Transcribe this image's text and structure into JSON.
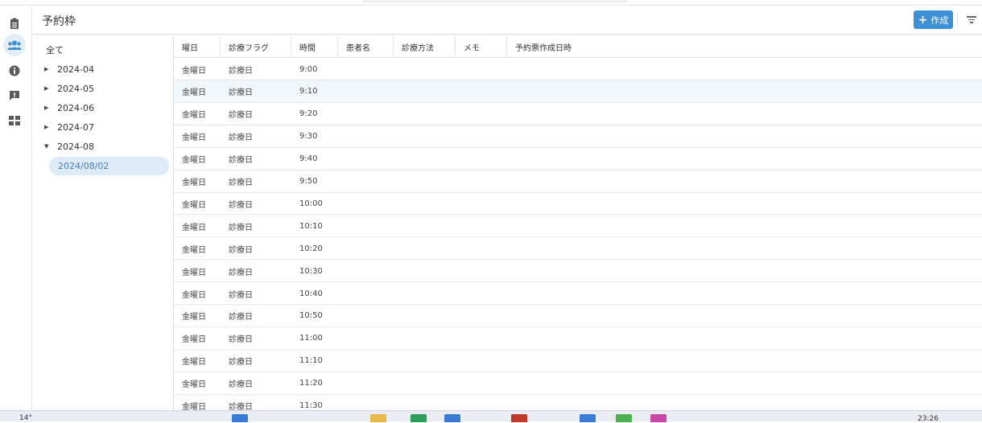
{
  "header": {
    "title": "予約枠",
    "create_label": "作成"
  },
  "icons": {
    "rail": [
      "clipboard-icon",
      "users-icon",
      "info-icon",
      "feedback-icon",
      "dashboard-icon"
    ],
    "create": "plus-icon",
    "filter": "filter-icon"
  },
  "colors": {
    "accent": "#3d8fd6",
    "selected_bg": "#ddeaf7",
    "selected_text": "#4a7fb5",
    "hover_row": "#f2f7fc"
  },
  "tree": {
    "all_label": "全て",
    "months": [
      {
        "label": "2024-04",
        "expanded": false
      },
      {
        "label": "2024-05",
        "expanded": false
      },
      {
        "label": "2024-06",
        "expanded": false
      },
      {
        "label": "2024-07",
        "expanded": false
      },
      {
        "label": "2024-08",
        "expanded": true
      }
    ],
    "selected_day": "2024/08/02"
  },
  "table": {
    "columns": [
      "曜日",
      "診療フラグ",
      "時間",
      "患者名",
      "診療方法",
      "メモ",
      "予約票作成日時"
    ],
    "rows": [
      {
        "weekday": "金曜日",
        "flag": "診療日",
        "time": "9:00"
      },
      {
        "weekday": "金曜日",
        "flag": "診療日",
        "time": "9:10"
      },
      {
        "weekday": "金曜日",
        "flag": "診療日",
        "time": "9:20"
      },
      {
        "weekday": "金曜日",
        "flag": "診療日",
        "time": "9:30"
      },
      {
        "weekday": "金曜日",
        "flag": "診療日",
        "time": "9:40"
      },
      {
        "weekday": "金曜日",
        "flag": "診療日",
        "time": "9:50"
      },
      {
        "weekday": "金曜日",
        "flag": "診療日",
        "time": "10:00"
      },
      {
        "weekday": "金曜日",
        "flag": "診療日",
        "time": "10:10"
      },
      {
        "weekday": "金曜日",
        "flag": "診療日",
        "time": "10:20"
      },
      {
        "weekday": "金曜日",
        "flag": "診療日",
        "time": "10:30"
      },
      {
        "weekday": "金曜日",
        "flag": "診療日",
        "time": "10:40"
      },
      {
        "weekday": "金曜日",
        "flag": "診療日",
        "time": "10:50"
      },
      {
        "weekday": "金曜日",
        "flag": "診療日",
        "time": "11:00"
      },
      {
        "weekday": "金曜日",
        "flag": "診療日",
        "time": "11:10"
      },
      {
        "weekday": "金曜日",
        "flag": "診療日",
        "time": "11:20"
      },
      {
        "weekday": "金曜日",
        "flag": "診療日",
        "time": "11:30"
      }
    ],
    "highlighted_row": 1
  },
  "taskbar": {
    "temperature": "14°",
    "clock": "23:26"
  }
}
